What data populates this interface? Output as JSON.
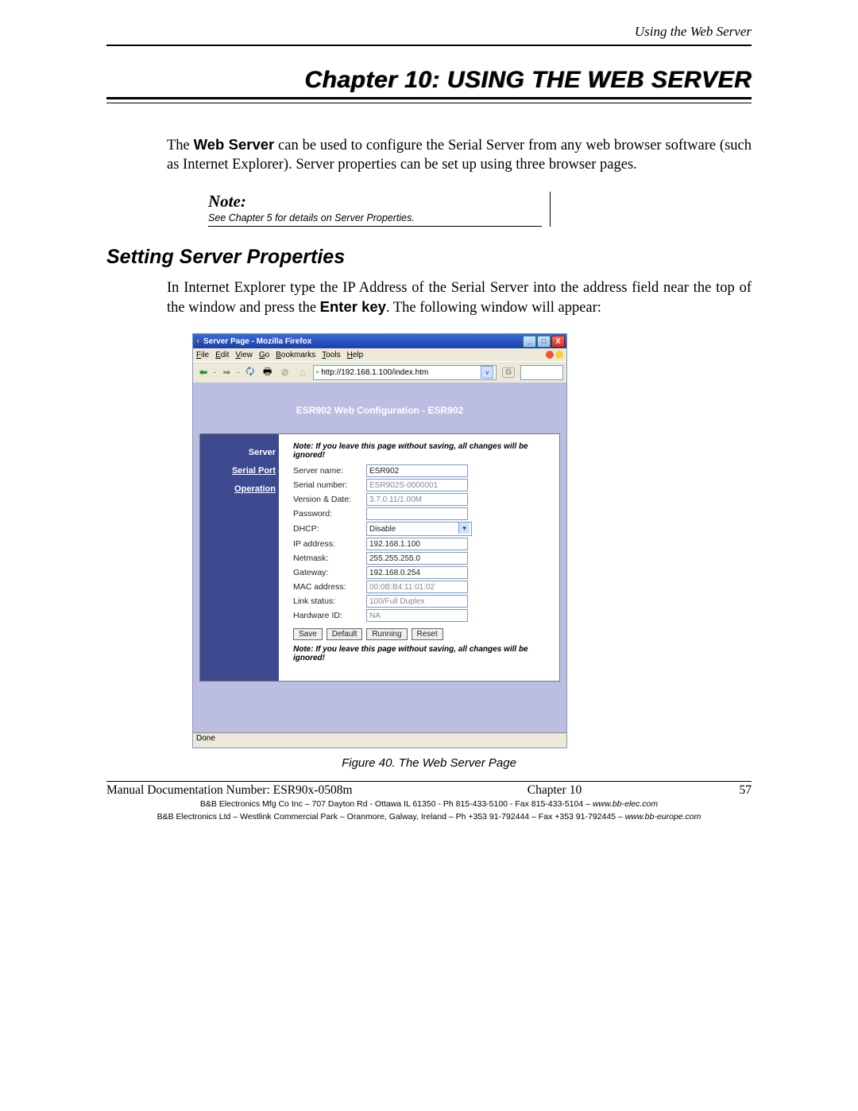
{
  "header": {
    "running": "Using the Web Server"
  },
  "chapter": {
    "title": "Chapter 10:  USING THE WEB SERVER"
  },
  "intro": {
    "pre": "The ",
    "bold": "Web Server",
    "post": " can be used to configure the Serial Server from any web browser software (such as Internet Explorer). Server properties can be set up using three browser pages."
  },
  "note": {
    "label": "Note:",
    "body": "See Chapter 5 for details on Server Properties."
  },
  "section": {
    "title": "Setting Server Properties"
  },
  "section_body": {
    "a": "In Internet Explorer type the IP Address of the Serial Server into the address field near the top of the window and press the ",
    "bold": "Enter key",
    "b": ". The following window will appear:"
  },
  "browser": {
    "title_app": "Server Page - Mozilla Firefox",
    "menus": [
      "File",
      "Edit",
      "View",
      "Go",
      "Bookmarks",
      "Tools",
      "Help"
    ],
    "url": "http://192.168.1.100/index.htm",
    "go": "G",
    "config_title": "ESR902 Web Configuration - ESR902",
    "nav": {
      "server": "Server",
      "serial": "Serial Port",
      "operation": "Operation"
    },
    "warn": "Note: If you leave this page without saving, all changes will be ignored!",
    "fields": {
      "server_name": {
        "label": "Server name:",
        "value": "ESR902"
      },
      "serial_number": {
        "label": "Serial number:",
        "value": "ESR902S-0000001"
      },
      "version_date": {
        "label": "Version & Date:",
        "value": "3.7.0.11/1.00M"
      },
      "password": {
        "label": "Password:",
        "value": ""
      },
      "dhcp": {
        "label": "DHCP:",
        "value": "Disable"
      },
      "ip_address": {
        "label": "IP address:",
        "value": "192.168.1.100"
      },
      "netmask": {
        "label": "Netmask:",
        "value": "255.255.255.0"
      },
      "gateway": {
        "label": "Gateway:",
        "value": "192.168.0.254"
      },
      "mac_address": {
        "label": "MAC address:",
        "value": "00:0B:B4:11:01:02"
      },
      "link_status": {
        "label": "Link status:",
        "value": "100/Full Duplex"
      },
      "hardware_id": {
        "label": "Hardware ID:",
        "value": "NA"
      }
    },
    "buttons": {
      "save": "Save",
      "default": "Default",
      "running": "Running",
      "reset": "Reset"
    },
    "status": "Done"
  },
  "figure": {
    "caption": "Figure 40.   The Web Server Page"
  },
  "footer": {
    "left": "Manual Documentation Number: ESR90x-0508m",
    "center": "Chapter 10",
    "right": "57",
    "line1_a": "B&B Electronics Mfg Co Inc – 707 Dayton Rd - Ottawa IL 61350 - Ph 815-433-5100 - Fax 815-433-5104 – ",
    "line1_b": "www.bb-elec.com",
    "line2_a": "B&B Electronics Ltd – Westlink Commercial Park – Oranmore, Galway, Ireland – Ph +353 91-792444 – Fax +353 91-792445 – ",
    "line2_b": "www.bb-europe.com"
  }
}
